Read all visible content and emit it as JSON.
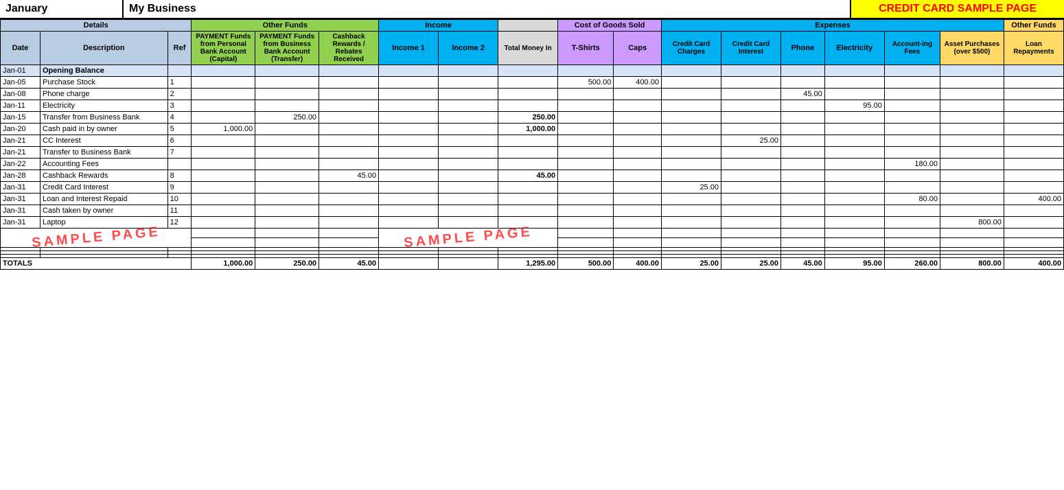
{
  "header": {
    "month": "January",
    "business": "My Business",
    "credit_title": "CREDIT CARD SAMPLE PAGE"
  },
  "sections": {
    "details": "Details",
    "other_funds": "Other Funds",
    "income": "Income",
    "cogs": "Cost of Goods Sold",
    "expenses": "Expenses",
    "other_funds2": "Other Funds"
  },
  "col_headers": {
    "date": "Date",
    "description": "Description",
    "ref": "Ref",
    "payment_personal": "PAYMENT Funds from Personal Bank Account (Capital)",
    "payment_business": "PAYMENT Funds from Business Bank Account (Transfer)",
    "cashback": "Cashback Rewards / Rebates Received",
    "income1": "Income 1",
    "income2": "Income 2",
    "total_money_in": "Total Money In",
    "tshirts": "T-Shirts",
    "caps": "Caps",
    "cc_charges": "Credit Card Charges",
    "cc_interest": "Credit Card Interest",
    "phone": "Phone",
    "electricity": "Electricity",
    "accounting_fees": "Account-ing Fees",
    "asset_purchases": "Asset Purchases (over $500)",
    "loan_repayments": "Loan Repayments"
  },
  "rows": [
    {
      "date": "Jan-01",
      "desc": "Opening Balance",
      "ref": "",
      "pay_personal": "",
      "pay_business": "",
      "cashback": "",
      "income1": "",
      "income2": "",
      "total_money_in": "",
      "tshirts": "",
      "caps": "",
      "cc_charges": "",
      "cc_interest": "",
      "phone": "",
      "electricity": "",
      "acct_fees": "",
      "asset_purchases": "",
      "loan_rep": "",
      "opening": true
    },
    {
      "date": "Jan-05",
      "desc": "Purchase Stock",
      "ref": "1",
      "pay_personal": "",
      "pay_business": "",
      "cashback": "",
      "income1": "",
      "income2": "",
      "total_money_in": "",
      "tshirts": "500.00",
      "caps": "400.00",
      "cc_charges": "",
      "cc_interest": "",
      "phone": "",
      "electricity": "",
      "acct_fees": "",
      "asset_purchases": "",
      "loan_rep": ""
    },
    {
      "date": "Jan-08",
      "desc": "Phone charge",
      "ref": "2",
      "pay_personal": "",
      "pay_business": "",
      "cashback": "",
      "income1": "",
      "income2": "",
      "total_money_in": "",
      "tshirts": "",
      "caps": "",
      "cc_charges": "",
      "cc_interest": "",
      "phone": "45.00",
      "electricity": "",
      "acct_fees": "",
      "asset_purchases": "",
      "loan_rep": ""
    },
    {
      "date": "Jan-11",
      "desc": "Electricity",
      "ref": "3",
      "pay_personal": "",
      "pay_business": "",
      "cashback": "",
      "income1": "",
      "income2": "",
      "total_money_in": "",
      "tshirts": "",
      "caps": "",
      "cc_charges": "",
      "cc_interest": "",
      "phone": "",
      "electricity": "95.00",
      "acct_fees": "",
      "asset_purchases": "",
      "loan_rep": ""
    },
    {
      "date": "Jan-15",
      "desc": "Transfer from Business Bank",
      "ref": "4",
      "pay_personal": "",
      "pay_business": "250.00",
      "cashback": "",
      "income1": "",
      "income2": "",
      "total_money_in": "250.00",
      "tshirts": "",
      "caps": "",
      "cc_charges": "",
      "cc_interest": "",
      "phone": "",
      "electricity": "",
      "acct_fees": "",
      "asset_purchases": "",
      "loan_rep": ""
    },
    {
      "date": "Jan-20",
      "desc": "Cash paid in by owner",
      "ref": "5",
      "pay_personal": "1,000.00",
      "pay_business": "",
      "cashback": "",
      "income1": "",
      "income2": "",
      "total_money_in": "1,000.00",
      "tshirts": "",
      "caps": "",
      "cc_charges": "",
      "cc_interest": "",
      "phone": "",
      "electricity": "",
      "acct_fees": "",
      "asset_purchases": "",
      "loan_rep": ""
    },
    {
      "date": "Jan-21",
      "desc": "CC Interest",
      "ref": "6",
      "pay_personal": "",
      "pay_business": "",
      "cashback": "",
      "income1": "",
      "income2": "",
      "total_money_in": "",
      "tshirts": "",
      "caps": "",
      "cc_charges": "",
      "cc_interest": "25.00",
      "phone": "",
      "electricity": "",
      "acct_fees": "",
      "asset_purchases": "",
      "loan_rep": ""
    },
    {
      "date": "Jan-21",
      "desc": "Transfer to Business Bank",
      "ref": "7",
      "pay_personal": "",
      "pay_business": "",
      "cashback": "",
      "income1": "",
      "income2": "",
      "total_money_in": "",
      "tshirts": "",
      "caps": "",
      "cc_charges": "",
      "cc_interest": "",
      "phone": "",
      "electricity": "",
      "acct_fees": "",
      "asset_purchases": "",
      "loan_rep": ""
    },
    {
      "date": "Jan-22",
      "desc": "Accounting Fees",
      "ref": "",
      "pay_personal": "",
      "pay_business": "",
      "cashback": "",
      "income1": "",
      "income2": "",
      "total_money_in": "",
      "tshirts": "",
      "caps": "",
      "cc_charges": "",
      "cc_interest": "",
      "phone": "",
      "electricity": "",
      "acct_fees": "180.00",
      "asset_purchases": "",
      "loan_rep": ""
    },
    {
      "date": "Jan-28",
      "desc": "Cashback Rewards",
      "ref": "8",
      "pay_personal": "",
      "pay_business": "",
      "cashback": "45.00",
      "income1": "",
      "income2": "",
      "total_money_in": "45.00",
      "tshirts": "",
      "caps": "",
      "cc_charges": "",
      "cc_interest": "",
      "phone": "",
      "electricity": "",
      "acct_fees": "",
      "asset_purchases": "",
      "loan_rep": ""
    },
    {
      "date": "Jan-31",
      "desc": "Credit Card Interest",
      "ref": "9",
      "pay_personal": "",
      "pay_business": "",
      "cashback": "",
      "income1": "",
      "income2": "",
      "total_money_in": "",
      "tshirts": "",
      "caps": "",
      "cc_charges": "25.00",
      "cc_interest": "",
      "phone": "",
      "electricity": "",
      "acct_fees": "",
      "asset_purchases": "",
      "loan_rep": ""
    },
    {
      "date": "Jan-31",
      "desc": "Loan and Interest Repaid",
      "ref": "10",
      "pay_personal": "",
      "pay_business": "",
      "cashback": "",
      "income1": "",
      "income2": "",
      "total_money_in": "",
      "tshirts": "",
      "caps": "",
      "cc_charges": "",
      "cc_interest": "",
      "phone": "",
      "electricity": "",
      "acct_fees": "80.00",
      "asset_purchases": "",
      "loan_rep": "400.00"
    },
    {
      "date": "Jan-31",
      "desc": "Cash taken by owner",
      "ref": "11",
      "pay_personal": "",
      "pay_business": "",
      "cashback": "",
      "income1": "",
      "income2": "",
      "total_money_in": "",
      "tshirts": "",
      "caps": "",
      "cc_charges": "",
      "cc_interest": "",
      "phone": "",
      "electricity": "",
      "acct_fees": "",
      "asset_purchases": "",
      "loan_rep": ""
    },
    {
      "date": "Jan-31",
      "desc": "Laptop",
      "ref": "12",
      "pay_personal": "",
      "pay_business": "",
      "cashback": "",
      "income1": "",
      "income2": "",
      "total_money_in": "",
      "tshirts": "",
      "caps": "",
      "cc_charges": "",
      "cc_interest": "",
      "phone": "",
      "electricity": "",
      "acct_fees": "",
      "asset_purchases": "800.00",
      "loan_rep": ""
    }
  ],
  "extra_rows": 4,
  "totals": {
    "label": "TOTALS",
    "pay_personal": "1,000.00",
    "pay_business": "250.00",
    "cashback": "45.00",
    "income1": "",
    "income2": "",
    "total_money_in": "1,295.00",
    "tshirts": "500.00",
    "caps": "400.00",
    "cc_charges": "25.00",
    "cc_interest": "25.00",
    "phone": "45.00",
    "electricity": "95.00",
    "acct_fees": "260.00",
    "asset_purchases": "800.00",
    "loan_rep": "400.00"
  },
  "sample_text": "SAMPLE PAGE"
}
